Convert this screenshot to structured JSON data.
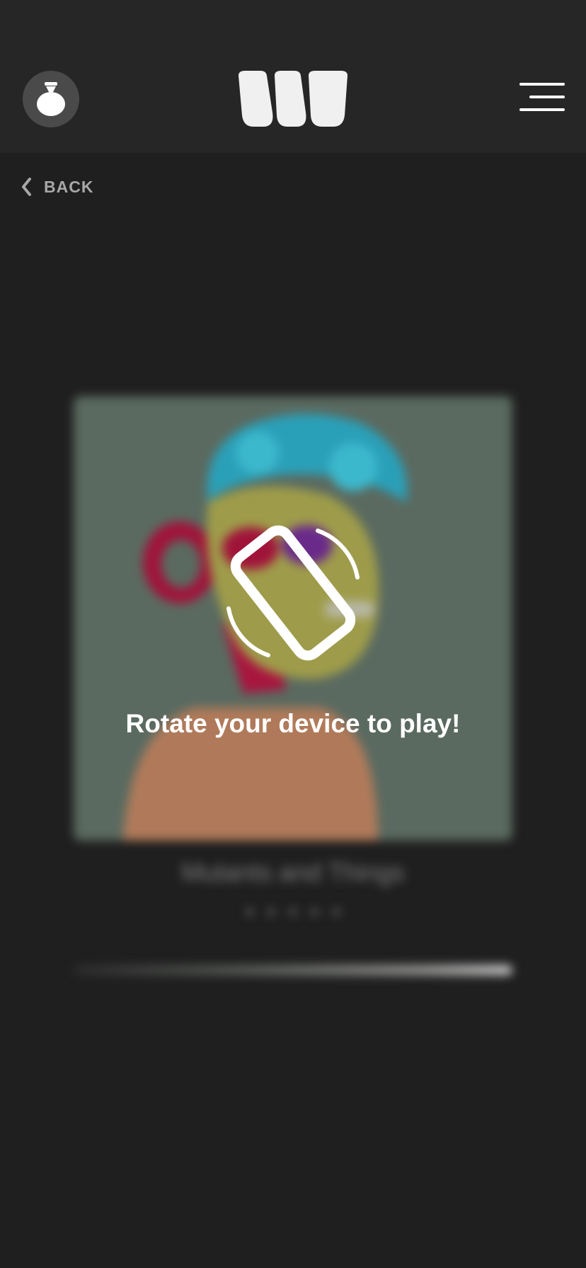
{
  "header": {
    "wallet_icon": "money-bag-icon",
    "logo_icon": "brand-logo",
    "menu_icon": "hamburger-menu-icon"
  },
  "nav": {
    "back_label": "BACK",
    "back_icon": "chevron-left-icon"
  },
  "game": {
    "title": "Mutants and Things",
    "rating": "★★★★★",
    "artwork": "pixel-art-ape-avatar"
  },
  "overlay": {
    "icon": "rotate-device-icon",
    "message": "Rotate your device to play!"
  },
  "colors": {
    "background": "#1f1f1f",
    "header_background": "#262626",
    "artwork_background": "#5a6a60"
  }
}
